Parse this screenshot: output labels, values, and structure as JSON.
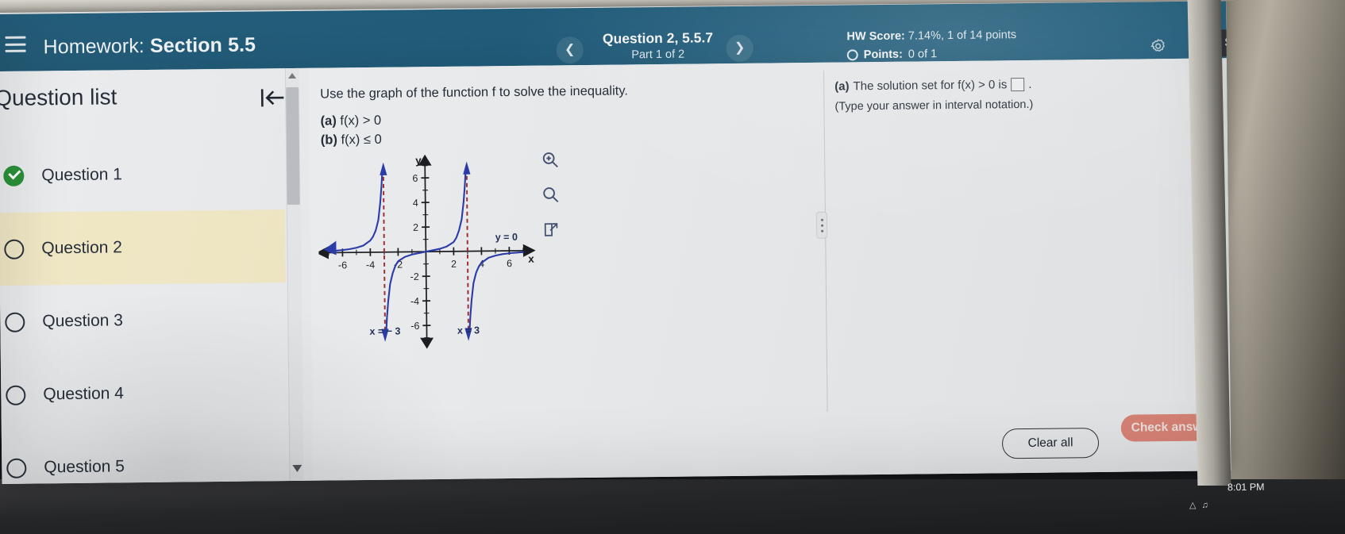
{
  "window": {
    "clock": "8:01 PM"
  },
  "header": {
    "menu_icon": "hamburger-menu-icon",
    "title_prefix": "Homework: ",
    "title_strong": "Section 5.5",
    "prev_icon": "chevron-left-icon",
    "next_icon": "chevron-right-icon",
    "question_label": "Question 2, 5.5.7",
    "part_label": "Part 1 of 2",
    "hw_score_label": "HW Score:",
    "hw_score_value": " 7.14%, 1 of 14 points",
    "points_label": "Points:",
    "points_value": " 0 of 1",
    "points_status_icon": "circle-empty-icon",
    "gear_icon": "gear-icon",
    "save_label": "Save",
    "bar_color": "#1b5c7d",
    "save_bg": "#23282c"
  },
  "sidebar": {
    "heading": "Question list",
    "collapse_icon": "collapse-panel-left-icon",
    "items": [
      {
        "label": "Question 1",
        "status": "complete",
        "active": false
      },
      {
        "label": "Question 2",
        "status": "incomplete",
        "active": true
      },
      {
        "label": "Question 3",
        "status": "incomplete",
        "active": false
      },
      {
        "label": "Question 4",
        "status": "incomplete",
        "active": false
      },
      {
        "label": "Question 5",
        "status": "incomplete",
        "active": false
      }
    ],
    "active_bg": "#f0e7c3",
    "complete_color": "#1f8b2e"
  },
  "question": {
    "prompt": "Use the graph of the function f to solve the inequality.",
    "part_a_tag": "(a) ",
    "part_a_text": "f(x) > 0",
    "part_b_tag": "(b) ",
    "part_b_text": "f(x) ≤ 0",
    "tools": [
      {
        "name": "zoom-in-icon"
      },
      {
        "name": "zoom-out-icon"
      },
      {
        "name": "open-in-new-window-icon"
      }
    ],
    "drag_handle_icon": "drag-handle-icon"
  },
  "answer": {
    "part_tag": "(a) ",
    "part_text_before": "The solution set for f(x) > 0 is",
    "part_text_after": ".",
    "input_value": "",
    "input_placeholder": "",
    "hint": "(Type your answer in interval notation.)",
    "clear_all_label": "Clear all",
    "check_answer_label": "Check answer",
    "check_answer_color": "#e08070"
  },
  "chart_data": {
    "type": "line",
    "title": "",
    "xlabel": "x",
    "ylabel": "y",
    "xlim": [
      -7.2,
      7.2
    ],
    "ylim": [
      -7.2,
      7.2
    ],
    "xticks": [
      -6,
      -4,
      -2,
      2,
      4,
      6
    ],
    "xtick_labels": [
      "-6",
      "-4",
      "-2",
      "2",
      "4",
      "6"
    ],
    "yticks": [
      6,
      4,
      2,
      -2,
      -4,
      -6
    ],
    "ytick_labels": [
      "6",
      "4",
      "2",
      "-2",
      "-4",
      "-6"
    ],
    "grid": false,
    "legend": "none",
    "curve_color": "#2436a8",
    "asymptote_color": "#9e2b2b",
    "annotations": [
      {
        "text": "y = 0",
        "x": 5.0,
        "y": 0.85,
        "kind": "horizontal-asymptote-label"
      },
      {
        "text": "x = − 3",
        "x": -3.0,
        "y": -6.7,
        "kind": "vertical-asymptote-label"
      },
      {
        "text": "x = 3",
        "x": 3.0,
        "y": -6.7,
        "kind": "vertical-asymptote-label"
      }
    ],
    "vertical_asymptotes": [
      -3,
      3
    ],
    "horizontal_asymptote": 0,
    "branches": [
      {
        "name": "left-branch",
        "domain": [
          -7.0,
          -3.0
        ],
        "描述": "approaches y=0 from above as x→-∞, rises to +∞ at x=-3⁻"
      },
      {
        "name": "middle-branch",
        "domain": [
          -3.0,
          3.0
        ],
        "描述": "falls from -∞ at x=-3⁺, crosses near y=0 between -2 and 2, rises to +∞ at x=3⁻"
      },
      {
        "name": "right-branch",
        "domain": [
          3.0,
          7.0
        ],
        "описание": "falls from -∞ at x=3⁺, approaches y=0 from below as x→+∞"
      }
    ],
    "series": [
      {
        "name": "f(x) left branch",
        "x": [
          -7.0,
          -6.5,
          -6.0,
          -5.5,
          -5.0,
          -4.5,
          -4.0,
          -3.8,
          -3.6,
          -3.4,
          -3.25,
          -3.15,
          -3.08
        ],
        "y": [
          0.12,
          0.16,
          0.2,
          0.27,
          0.38,
          0.55,
          0.95,
          1.25,
          1.75,
          2.6,
          4.0,
          5.3,
          6.5
        ]
      },
      {
        "name": "f(x) middle branch",
        "x": [
          -2.92,
          -2.85,
          -2.75,
          -2.6,
          -2.4,
          -2.2,
          -2.0,
          -1.5,
          -1.0,
          0.0,
          1.0,
          1.5,
          2.0,
          2.2,
          2.4,
          2.6,
          2.75,
          2.85,
          2.92
        ],
        "y": [
          -6.5,
          -5.3,
          -4.0,
          -2.6,
          -1.7,
          -1.1,
          -0.75,
          -0.4,
          -0.22,
          0.0,
          0.22,
          0.4,
          0.75,
          1.1,
          1.7,
          2.6,
          4.0,
          5.3,
          6.5
        ]
      },
      {
        "name": "f(x) right branch",
        "x": [
          3.08,
          3.15,
          3.25,
          3.4,
          3.6,
          3.8,
          4.0,
          4.5,
          5.0,
          5.5,
          6.0,
          6.5,
          7.0
        ],
        "y": [
          -6.5,
          -5.3,
          -4.0,
          -2.6,
          -1.75,
          -1.25,
          -0.95,
          -0.55,
          -0.38,
          -0.27,
          -0.2,
          -0.16,
          -0.12
        ]
      }
    ]
  }
}
